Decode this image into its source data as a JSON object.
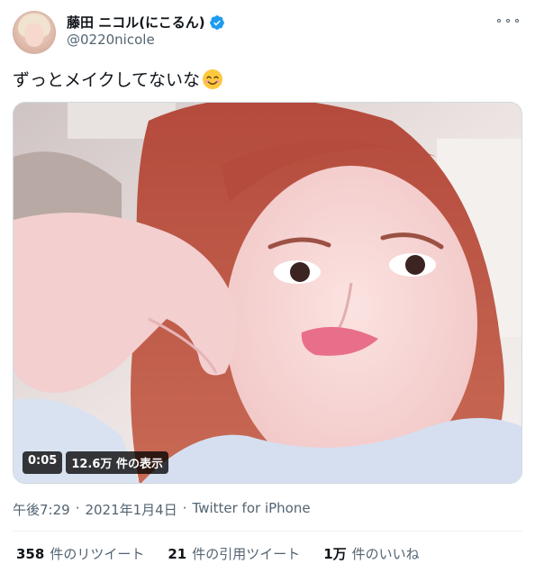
{
  "user": {
    "display_name": "藤田 ニコル(にこるん)",
    "handle": "@0220nicole",
    "verified": true
  },
  "tweet": {
    "text": "ずっとメイクしてないな",
    "emoji": "smiling-face-emoji"
  },
  "media": {
    "duration": "0:05",
    "views": "12.6万 件の表示"
  },
  "meta": {
    "time": "午後7:29",
    "separator1": "·",
    "date": "2021年1月4日",
    "separator2": "·",
    "source": "Twitter for iPhone"
  },
  "stats": [
    {
      "num": "358",
      "label": "件のリツイート"
    },
    {
      "num": "21",
      "label": "件の引用ツイート"
    },
    {
      "num": "1万",
      "label": "件のいいね"
    }
  ],
  "colors": {
    "verified": "#1d9bf0",
    "muted": "#536471",
    "text": "#0f1419"
  }
}
